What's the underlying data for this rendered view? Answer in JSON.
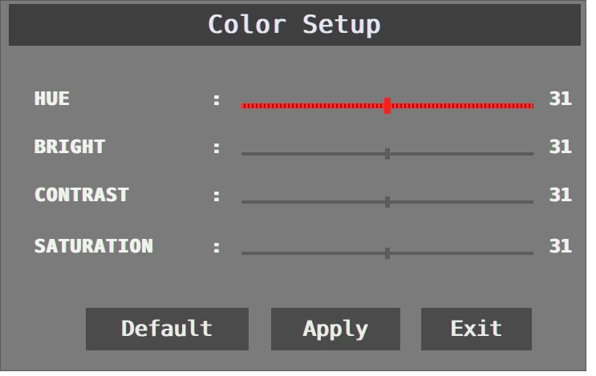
{
  "title": "Color Setup",
  "rows": [
    {
      "label": "HUE",
      "colon": ":",
      "value": "31",
      "level": 0.5
    },
    {
      "label": "BRIGHT",
      "colon": ":",
      "value": "31",
      "level": 0.5
    },
    {
      "label": "CONTRAST",
      "colon": ":",
      "value": "31",
      "level": 0.5
    },
    {
      "label": "SATURATION",
      "colon": ":",
      "value": "31",
      "level": 0.5
    }
  ],
  "selected_row": "HUE",
  "buttons": {
    "default_label": "Default",
    "apply_label": "Apply",
    "exit_label": "Exit"
  },
  "colors": {
    "panel": "#7b7b7b",
    "title_bar": "#3f3f3f",
    "button": "#4b4b4b",
    "active_slider": "#ff1e1e",
    "inactive_slider": "#5c5c5c"
  }
}
